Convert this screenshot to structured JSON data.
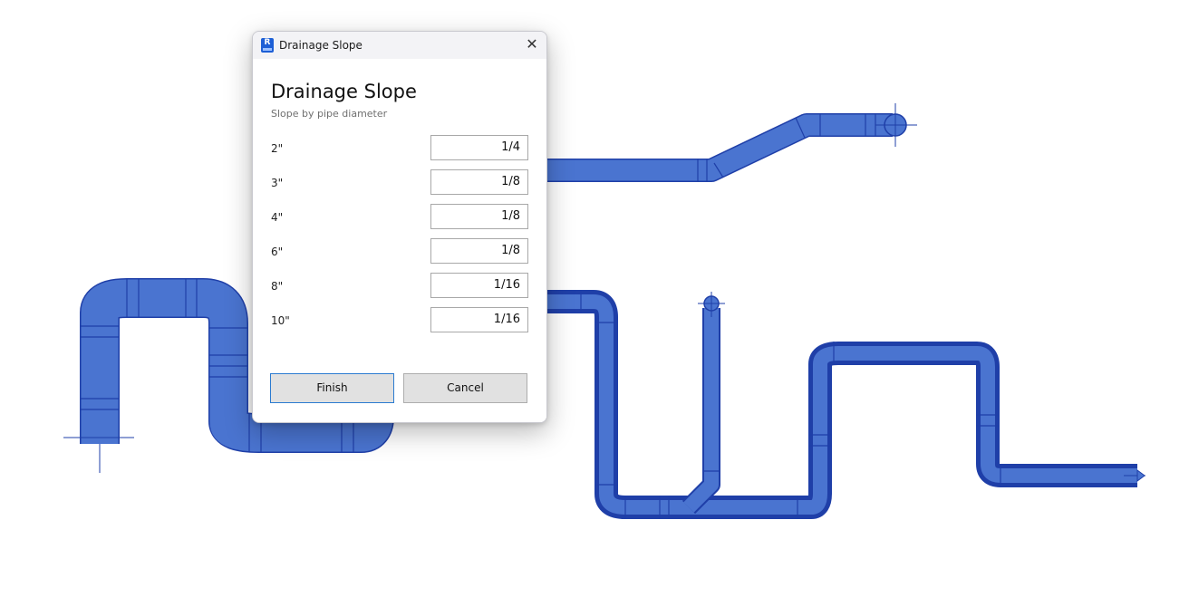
{
  "dialog": {
    "window_title": "Drainage Slope",
    "app_icon_letter": "R",
    "close_glyph": "✕",
    "heading": "Drainage Slope",
    "subheading": "Slope by pipe diameter",
    "rows": [
      {
        "diameter": "2\"",
        "slope": "1/4"
      },
      {
        "diameter": "3\"",
        "slope": "1/8"
      },
      {
        "diameter": "4\"",
        "slope": "1/8"
      },
      {
        "diameter": "6\"",
        "slope": "1/8"
      },
      {
        "diameter": "8\"",
        "slope": "1/16"
      },
      {
        "diameter": "10\"",
        "slope": "1/16"
      }
    ],
    "finish_label": "Finish",
    "cancel_label": "Cancel"
  },
  "colors": {
    "pipe_fill": "#4a74d0",
    "pipe_edge": "#1f3fa8",
    "accent": "#2b7bd0"
  },
  "icons": {
    "app": "revit-app-icon",
    "close": "close-icon"
  }
}
